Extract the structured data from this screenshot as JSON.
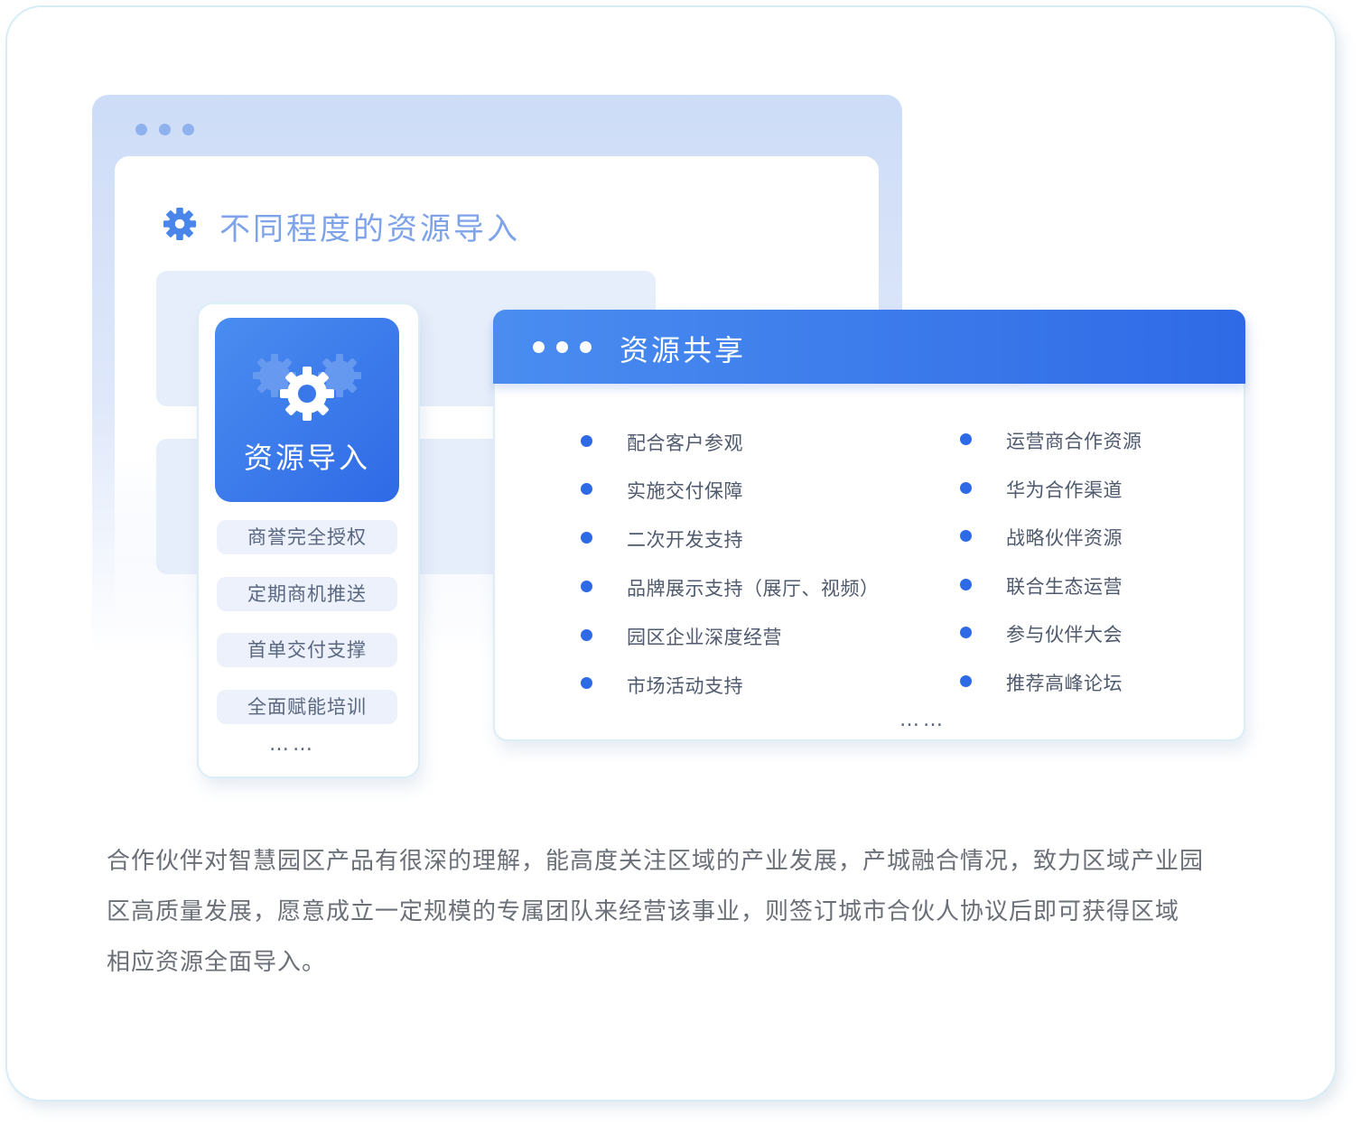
{
  "background_window": {
    "title": "不同程度的资源导入",
    "title_icon": "gear-icon"
  },
  "import_card": {
    "title": "资源导入",
    "icon": "gears-icon",
    "items": [
      "商誉完全授权",
      "定期商机推送",
      "首单交付支撑",
      "全面赋能培训"
    ],
    "more": "……"
  },
  "share_card": {
    "title": "资源共享",
    "left_items": [
      "配合客户参观",
      "实施交付保障",
      "二次开发支持",
      "品牌展示支持（展厅、视频）",
      "园区企业深度经营",
      "市场活动支持"
    ],
    "right_items": [
      "运营商合作资源",
      "华为合作渠道",
      "战略伙伴资源",
      "联合生态运营",
      "参与伙伴大会",
      "推荐高峰论坛"
    ],
    "more": "……"
  },
  "description": {
    "line1": "合作伙伴对智慧园区产品有很深的理解，能高度关注区域的产业发展，产城融合情况，致力区域产业园",
    "line2": "区高质量发展，愿意成立一定规模的专属团队来经营该事业，则签订城市合伙人协议后即可获得区域",
    "line3": "相应资源全面导入。"
  },
  "colors": {
    "primary": "#2f6ae6",
    "primary_light": "#4a8df0",
    "title_light_blue": "#7ea3ea",
    "pill_bg": "#ecf1fb",
    "text_gray": "#6b6f78"
  }
}
